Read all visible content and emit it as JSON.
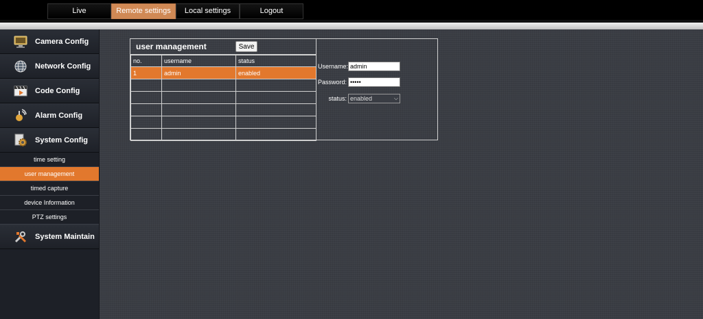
{
  "nav": {
    "tabs": [
      {
        "label": "Live"
      },
      {
        "label": "Remote settings",
        "active": true
      },
      {
        "label": "Local settings"
      },
      {
        "label": "Logout"
      }
    ]
  },
  "sidebar": {
    "items": [
      {
        "label": "Camera Config",
        "icon": "monitor-icon"
      },
      {
        "label": "Network Config",
        "icon": "globe-icon"
      },
      {
        "label": "Code Config",
        "icon": "film-icon"
      },
      {
        "label": "Alarm Config",
        "icon": "alarm-icon"
      },
      {
        "label": "System Config",
        "icon": "gear-icon"
      }
    ],
    "subitems": [
      {
        "label": "time setting"
      },
      {
        "label": "user management",
        "active": true
      },
      {
        "label": "timed capture"
      },
      {
        "label": "device Information"
      },
      {
        "label": "PTZ settings"
      }
    ],
    "maintain": {
      "label": "System Maintain",
      "icon": "tools-icon"
    }
  },
  "panel": {
    "title": "user management",
    "save_label": "Save",
    "table": {
      "headers": [
        "no.",
        "username",
        "status"
      ],
      "rows": [
        [
          "1",
          "admin",
          "enabled"
        ],
        [
          "",
          "",
          ""
        ],
        [
          "",
          "",
          ""
        ],
        [
          "",
          "",
          ""
        ],
        [
          "",
          "",
          ""
        ],
        [
          "",
          "",
          ""
        ]
      ]
    },
    "form": {
      "username_label": "Username:",
      "username_value": "admin",
      "password_label": "Password:",
      "password_value": "•••••",
      "status_label": "status:",
      "status_value": "enabled"
    }
  },
  "colors": {
    "accent": "#e2782d",
    "tab_active": "#d08955",
    "background": "#3a3d44",
    "sidebar": "#1d2027"
  }
}
